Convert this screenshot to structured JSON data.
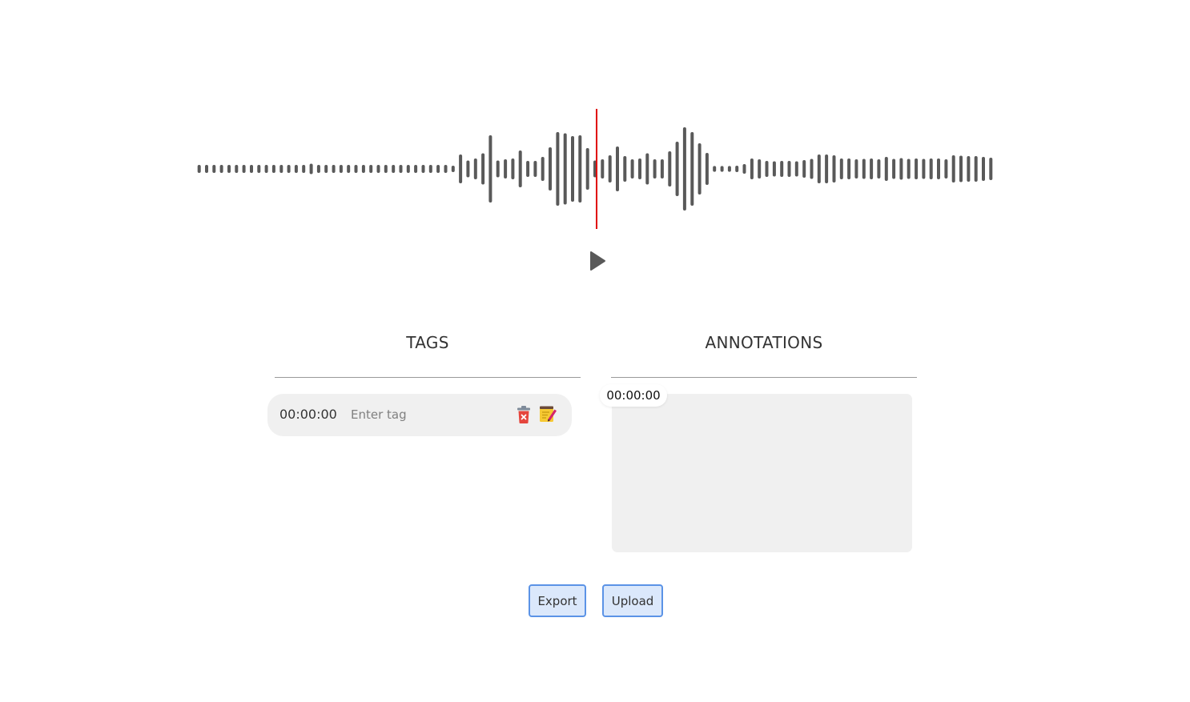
{
  "player": {
    "waveform_amplitudes": [
      0.06,
      0.06,
      0.06,
      0.06,
      0.06,
      0.06,
      0.06,
      0.06,
      0.06,
      0.06,
      0.06,
      0.06,
      0.06,
      0.06,
      0.06,
      0.09,
      0.06,
      0.06,
      0.06,
      0.06,
      0.06,
      0.06,
      0.06,
      0.06,
      0.06,
      0.06,
      0.06,
      0.06,
      0.06,
      0.06,
      0.06,
      0.06,
      0.06,
      0.06,
      0.04,
      0.32,
      0.17,
      0.22,
      0.35,
      0.8,
      0.17,
      0.2,
      0.22,
      0.42,
      0.16,
      0.16,
      0.26,
      0.5,
      0.88,
      0.85,
      0.78,
      0.8,
      0.48,
      0.17,
      0.2,
      0.3,
      0.52,
      0.28,
      0.2,
      0.22,
      0.35,
      0.2,
      0.2,
      0.4,
      0.64,
      1.0,
      0.88,
      0.6,
      0.36,
      0.02,
      0.02,
      0.02,
      0.04,
      0.08,
      0.22,
      0.2,
      0.16,
      0.15,
      0.16,
      0.16,
      0.15,
      0.18,
      0.21,
      0.32,
      0.32,
      0.3,
      0.22,
      0.22,
      0.2,
      0.21,
      0.22,
      0.2,
      0.26,
      0.21,
      0.23,
      0.21,
      0.22,
      0.21,
      0.22,
      0.22,
      0.2,
      0.3,
      0.29,
      0.28,
      0.28,
      0.26,
      0.24
    ],
    "playhead_fraction": 0.5,
    "waveform_color": "#595959",
    "playhead_color": "#e00000",
    "play_icon": "play-icon"
  },
  "tags": {
    "title": "TAGS",
    "items": [
      {
        "time": "00:00:00",
        "placeholder": "Enter tag",
        "value": "",
        "delete_icon": "delete-icon",
        "edit_icon": "edit-note-icon"
      }
    ]
  },
  "annotations": {
    "title": "ANNOTATIONS",
    "current_time": "00:00:00",
    "text": ""
  },
  "actions": {
    "export_label": "Export",
    "upload_label": "Upload"
  },
  "colors": {
    "button_bg": "#dbe8fb",
    "button_border": "#5b93e6",
    "panel_bg": "#f0f0f0"
  }
}
